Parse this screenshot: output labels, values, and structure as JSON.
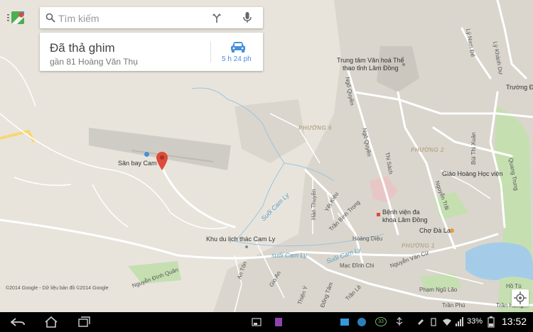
{
  "search": {
    "placeholder": "Tìm kiếm"
  },
  "place_card": {
    "title": "Đã thả ghim",
    "subtitle": "gần 81 Hoàng Văn Thụ",
    "travel_time": "5 h 24 ph"
  },
  "map": {
    "copyright": "©2014 Google - Dữ liệu bản đồ ©2014 Google",
    "pois": {
      "airport": "Sân bay Cam Ly",
      "culture_center": "Trung tâm Văn hoá Thể\nthao tỉnh Lâm Đồng",
      "hospital_line1": "Bệnh viện đa",
      "hospital_line2": "khoa Lâm Đồng",
      "market": "Chợ Đà Lạt",
      "seminary": "Giáo Hoàng Học viện",
      "waterfall": "Khu du lịch thác Cam Ly",
      "school": "Trường Đ"
    },
    "districts": {
      "p6": "PHƯỜNG 6",
      "p2": "PHƯỜNG 2",
      "p1": "PHƯỜNG 1"
    },
    "streams": {
      "s1": "Suối Cam Ly",
      "s2": "suối Cam Ly",
      "s3": "Suối Cam Ly"
    },
    "roads": {
      "ngo_quyen": "Ngô Quyền",
      "ngo_quyen2": "Ngô Quyền",
      "thi_sach": "Thi Sách",
      "han_thuyen": "Hàn Thuyên",
      "yet_kieu": "Yết Kiêu",
      "tran_binh_trong": "Trần Bình Trọng",
      "hoang_dieu": "Hoàng Diệu",
      "mac_dinh_chi": "Mạc Đĩnh Chi",
      "nguyen_van_cu": "Nguyễn Văn Cừ",
      "pham_ngu_lao": "Phạm Ngũ Lão",
      "tran_phu": "Trần Phú",
      "tran_hung_dao": "Trần Hưng",
      "ho_tung": "Hồ Tù",
      "bui_thi_xuan": "Bùi Thị Xuân",
      "quang_trung": "Quang Trung",
      "ly_nam_de": "Lý Nam Đế",
      "ly_khanh_du": "Lý Khánh Dư",
      "nguyen_trai": "Nguyễn Trãi",
      "nguyen_dinh_quan": "Nguyễn Đình Quân",
      "an_ton": "An Tôn",
      "gio_an": "Gio An",
      "thien_y": "Thiện Ý",
      "dong_tam": "Đống Tâm",
      "tran_le": "Trần Lê",
      "ly_nam": "Lý Nam Đế"
    }
  },
  "status_bar": {
    "time": "13:52",
    "battery": "33%",
    "notification_badge": "33"
  },
  "colors": {
    "land": "#e8e4dc",
    "urban": "#dad6cd",
    "park": "#c5dfb1",
    "water": "#a4cce8",
    "road": "#ffffff",
    "highway": "#f7d774",
    "pin": "#dd4b39",
    "accent": "#4a90d9"
  }
}
